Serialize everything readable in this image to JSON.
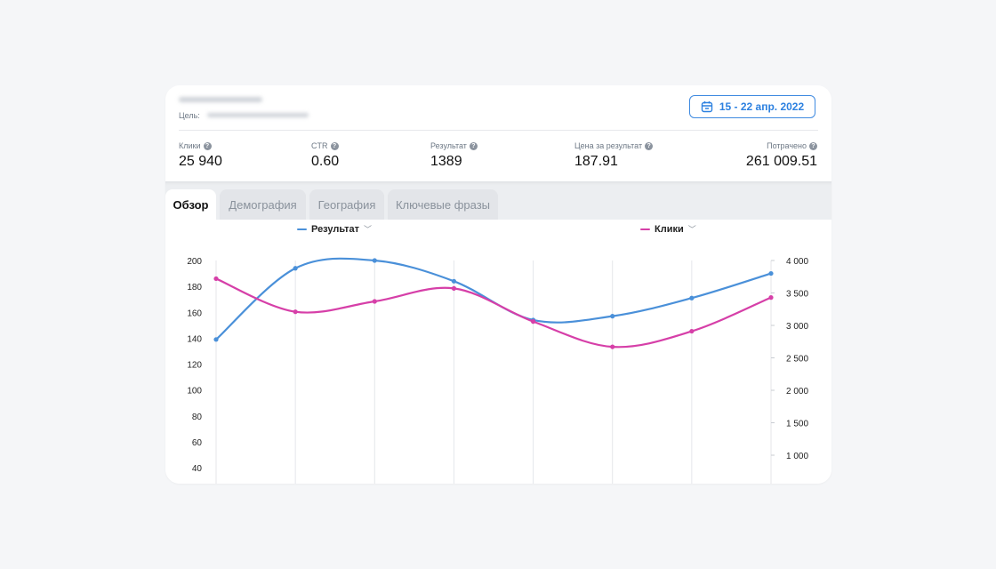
{
  "header": {
    "goal_label": "Цель:",
    "date_range": "15 - 22 апр. 2022"
  },
  "stats": [
    {
      "label": "Клики",
      "value": "25 940"
    },
    {
      "label": "CTR",
      "value": "0.60"
    },
    {
      "label": "Результат",
      "value": "1389"
    },
    {
      "label": "Цена за результат",
      "value": "187.91"
    },
    {
      "label": "Потрачено",
      "value": "261 009.51"
    }
  ],
  "tabs": [
    "Обзор",
    "Демография",
    "География",
    "Ключевые фразы"
  ],
  "active_tab": 0,
  "legend": {
    "left": {
      "label": "Результат",
      "color": "#4a90d9"
    },
    "right": {
      "label": "Клики",
      "color": "#d63fa8"
    }
  },
  "chart_data": {
    "type": "line",
    "left_axis": {
      "ticks": [
        "200",
        "180",
        "160",
        "140",
        "120",
        "100",
        "80",
        "60",
        "40"
      ],
      "range": [
        40,
        200
      ]
    },
    "right_axis": {
      "ticks": [
        "4 000",
        "3 500",
        "3 000",
        "2 500",
        "2 000",
        "1 500",
        "1 000"
      ],
      "range": [
        1000,
        4000
      ]
    },
    "series": [
      {
        "name": "Результат",
        "axis": "left",
        "color": "#4a90d9",
        "values": [
          139,
          194,
          200,
          184,
          154,
          157,
          171,
          190
        ]
      },
      {
        "name": "Клики",
        "axis": "right",
        "color": "#d63fa8",
        "values": [
          3720,
          3210,
          3370,
          3570,
          3060,
          2670,
          2910,
          3430
        ]
      }
    ]
  }
}
